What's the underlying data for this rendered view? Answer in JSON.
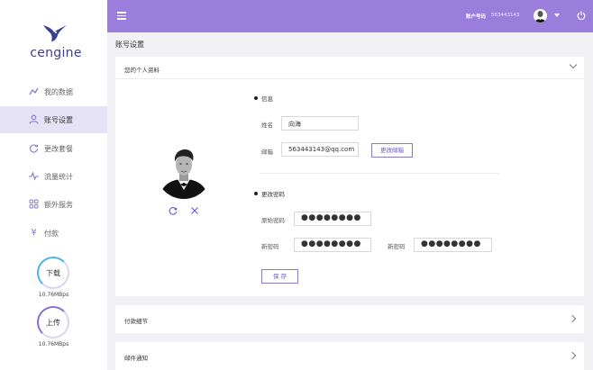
{
  "sidebar": {
    "logo_text": "cengine",
    "items": [
      {
        "label": "我的数据",
        "icon": "chart-line-icon"
      },
      {
        "label": "账号设置",
        "icon": "user-icon",
        "active": true
      },
      {
        "label": "更改套餐",
        "icon": "refresh-icon"
      },
      {
        "label": "流量统计",
        "icon": "pulse-icon"
      },
      {
        "label": "额外服务",
        "icon": "grid-icon"
      },
      {
        "label": "付款",
        "icon": "yen-icon"
      }
    ],
    "download": {
      "label": "下载",
      "speed": "10.76MBps"
    },
    "upload": {
      "label": "上传",
      "speed": "10.76MBps"
    }
  },
  "header": {
    "account_label": "账户号码",
    "account_value": "563443143"
  },
  "page": {
    "title": "账号设置"
  },
  "profile_card": {
    "title": "您的个人资料",
    "info_section": "信息",
    "name_label": "姓名",
    "name_value": "向海",
    "email_label": "邮箱",
    "email_value": "563443143@qq.com",
    "change_email_button": "更改邮箱",
    "password_section": "更改密码",
    "old_password_label": "原始密码",
    "new_password_label": "新密码",
    "confirm_password_label": "新密码",
    "old_password_value": "●●●●●●●●",
    "new_password_value": "●●●●●●●●",
    "confirm_password_value": "●●●●●●●●",
    "save_button": "保 存"
  },
  "payment_card": {
    "title": "付款细节"
  },
  "mail_card": {
    "title": "邮件通知"
  },
  "colors": {
    "header": "#9a7edc",
    "accent": "#8a79d6",
    "active_nav": "#e5e2f6",
    "logo": "#3d3f8f"
  }
}
